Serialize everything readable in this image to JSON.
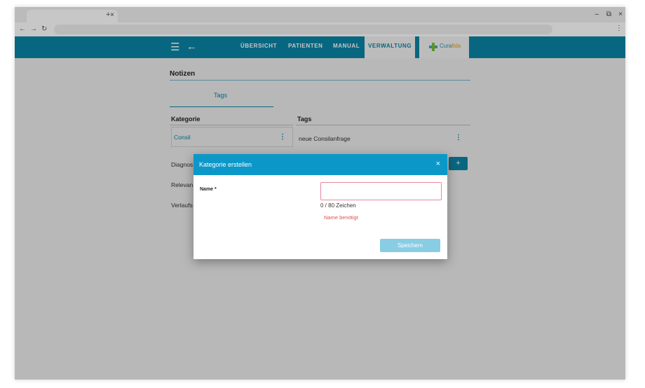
{
  "browser": {
    "tab_close": "×",
    "new_tab": "+",
    "controls": {
      "minimize": "–",
      "restore": "⧉",
      "close": "×"
    },
    "nav": {
      "back": "←",
      "forward": "→",
      "reload": "↻"
    },
    "menu": "⋮"
  },
  "appbar": {
    "menu_icon": "☰",
    "back_icon": "←",
    "nav": [
      "ÜBERSICHT",
      "PATIENTEN",
      "MANUAL",
      "VERWALTUNG"
    ],
    "active": "VERWALTUNG",
    "logo": {
      "part1": "Cura",
      "part2": "fida"
    }
  },
  "page": {
    "title": "Notizen",
    "subtab": "Tags",
    "col_kategorie": "Kategorie",
    "col_tags": "Tags",
    "categories": [
      "Consil",
      "Diagnos",
      "Relevan",
      "Verlaufs"
    ],
    "tags": [
      "neue Consilanfrage"
    ],
    "kebab": "⋮",
    "add": "+"
  },
  "dialog": {
    "title": "Kategorie erstellen",
    "close": "×",
    "name_label": "Name *",
    "name_value": "",
    "counter": "0 / 80 Zeichen",
    "error": "Name benötigt",
    "save": "Speichern"
  },
  "colors": {
    "primary": "#0b84a5",
    "dialog_header": "#0b98c9",
    "error": "#d9534f",
    "save_disabled": "#88cde3"
  }
}
